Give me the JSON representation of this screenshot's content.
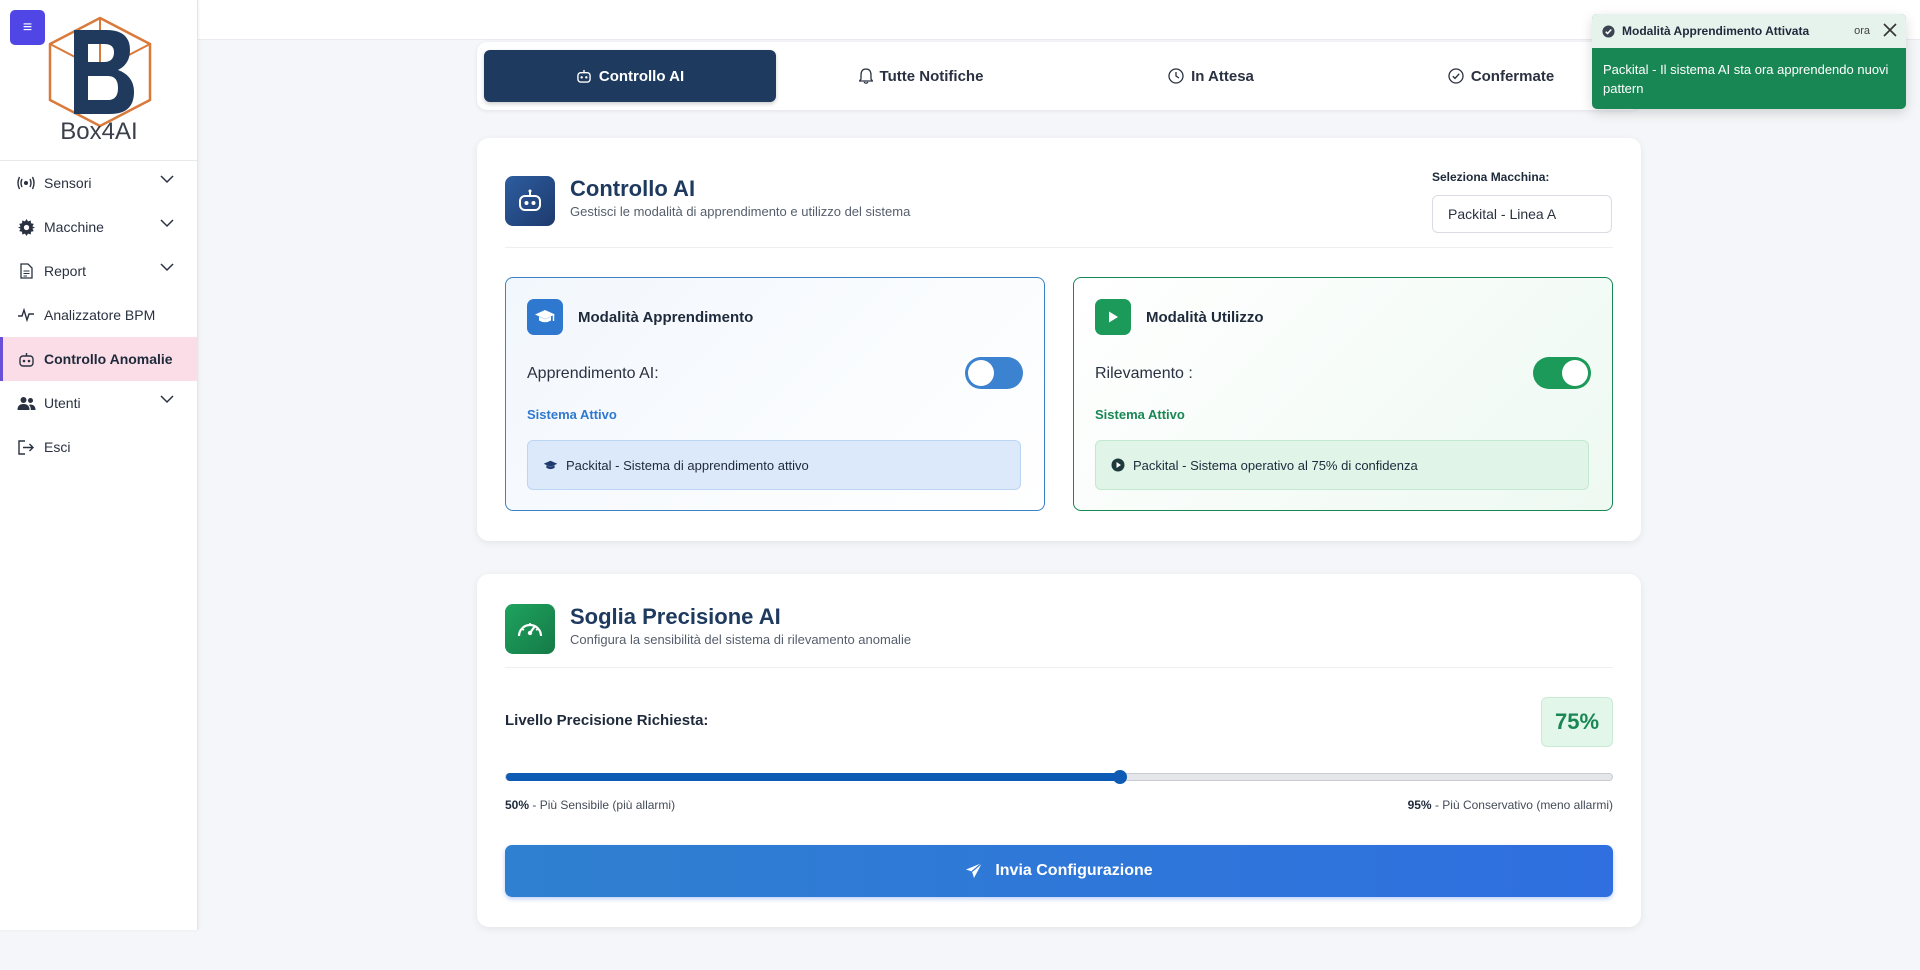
{
  "app": {
    "logo_text": "Box4AI",
    "menu_icon": "≡"
  },
  "sidebar": {
    "items": [
      {
        "label": "Sensori",
        "icon": "broadcast-icon",
        "has_chevron": true
      },
      {
        "label": "Macchine",
        "icon": "gear-icon",
        "has_chevron": true
      },
      {
        "label": "Report",
        "icon": "document-icon",
        "has_chevron": true
      },
      {
        "label": "Analizzatore BPM",
        "icon": "pulse-icon",
        "has_chevron": false
      },
      {
        "label": "Controllo Anomalie",
        "icon": "robot-icon",
        "has_chevron": false,
        "active": true
      },
      {
        "label": "Utenti",
        "icon": "users-icon",
        "has_chevron": true
      },
      {
        "label": "Esci",
        "icon": "logout-icon",
        "has_chevron": false
      }
    ]
  },
  "tabs": [
    {
      "label": "Controllo AI",
      "icon": "robot-icon",
      "active": true
    },
    {
      "label": "Tutte Notifiche",
      "icon": "bell-icon"
    },
    {
      "label": "In Attesa",
      "icon": "clock-icon"
    },
    {
      "label": "Confermate",
      "icon": "check-circle-icon"
    }
  ],
  "toast": {
    "title": "Modalità Apprendimento Attivata",
    "time": "ora",
    "message": "Packital - Il sistema AI sta ora apprendendo nuovi pattern"
  },
  "control_card": {
    "title": "Controllo AI",
    "subtitle": "Gestisci le modalità di apprendimento e utilizzo del sistema",
    "machine_label": "Seleziona Macchina:",
    "machine_value": "Packital - Linea A",
    "learning": {
      "title": "Modalità Apprendimento",
      "toggle_label": "Apprendimento AI:",
      "toggle_on": false,
      "status": "Sistema Attivo",
      "info": "Packital - Sistema di apprendimento attivo"
    },
    "usage": {
      "title": "Modalità Utilizzo",
      "toggle_label": "Rilevamento :",
      "toggle_on": true,
      "status": "Sistema Attivo",
      "info": "Packital - Sistema operativo al 75% di confidenza"
    }
  },
  "threshold_card": {
    "title": "Soglia Precisione AI",
    "subtitle": "Configura la sensibilità del sistema di rilevamento anomalie",
    "level_label": "Livello Precisione Richiesta:",
    "value_text": "75%",
    "slider": {
      "min": 50,
      "max": 95,
      "value": 75
    },
    "min_value": "50%",
    "min_desc": " - Più Sensibile (più allarmi)",
    "max_value": "95%",
    "max_desc": " - Più Conservativo (meno allarmi)",
    "submit_label": "Invia Configurazione"
  },
  "colors": {
    "accent_dark": "#1e3a5f",
    "learn_blue": "#3b82c4",
    "use_green": "#198754",
    "sidebar_active": "#fadde7",
    "menu_button": "#4f46e5"
  }
}
